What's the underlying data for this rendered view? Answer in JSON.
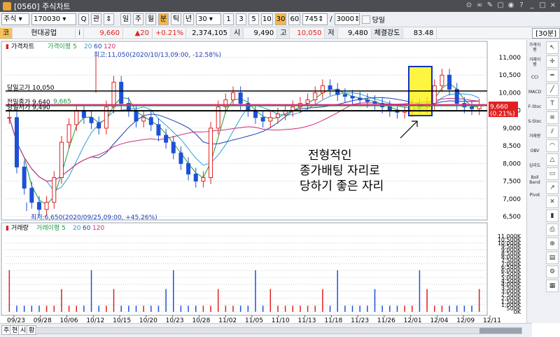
{
  "window": {
    "title": "[0560] 주식차트"
  },
  "toolbar": {
    "market": "주식",
    "code": "170030",
    "search_glyph": "Q",
    "gwan": "관",
    "period_buttons": [
      "일",
      "주",
      "월",
      "분",
      "틱",
      "년"
    ],
    "interval_value": "30",
    "interval_buttons": [
      "1",
      "3",
      "5",
      "10",
      "30",
      "60"
    ],
    "active_interval": "30",
    "count_value": "745",
    "total_value": "3000",
    "sameday_label": "당일"
  },
  "infobar": {
    "market_tag": "코",
    "stock_name": "현대공업",
    "info_glyph": "i",
    "price": "9,660",
    "change": "▲20",
    "change_pct": "+0.21%",
    "volume": "2,374,105",
    "open_label": "시",
    "open": "9,490",
    "high_label": "고",
    "high": "10,050",
    "low_label": "저",
    "low": "9,480",
    "strength_label": "체결강도",
    "strength": "83.48",
    "interval_tag": "[30분]"
  },
  "price_panel": {
    "legend_title": "가격차트",
    "legend_ma": "가격이평 5",
    "legend_ma_periods": [
      "20",
      "60",
      "120"
    ],
    "high_note": "최고:11,050(2020/10/13,09:00, -12.58%)",
    "low_note": "최저:6,650(2020/09/25,09:00, +45.26%)",
    "line_labels": {
      "day_high": "당일고가 10,050",
      "prev_close": "전일종가 9,640",
      "ma_value": "9,665",
      "day_low": "당일저가 9,490"
    },
    "current_price_tag": "9,660",
    "current_pct_tag": "(0.21%)",
    "annotation": [
      "전형적인",
      "종가배팅 자리로",
      "당하기 좋은 자리"
    ]
  },
  "volume_panel": {
    "legend_title": "거래량",
    "legend_ma": "거래이평 5",
    "legend_ma_periods": [
      "20",
      "60",
      "120"
    ]
  },
  "chart_data": {
    "type": "line",
    "title": "가격차트",
    "price_axis": {
      "ylim": [
        6500,
        11000
      ],
      "ticks": [
        11000,
        10500,
        10000,
        9500,
        9000,
        8500,
        8000,
        7500,
        7000,
        6500
      ]
    },
    "volume_axis": {
      "ylim": [
        0,
        11000
      ],
      "tick_labels": [
        "11,000K",
        "10,500K",
        "10,000K",
        "9,500K",
        "9,000K",
        "8,500K",
        "8,000K",
        "7,500K",
        "7,000K",
        "6,500K",
        "6,000K",
        "5,500K",
        "5,000K",
        "4,500K",
        "4,000K",
        "3,500K",
        "3,000K",
        "2,500K",
        "2,000K",
        "1,500K",
        "1,000K",
        "500K",
        "0K"
      ]
    },
    "x_dates": [
      "09/23",
      "09/28",
      "10/06",
      "10/12",
      "10/15",
      "10/20",
      "10/23",
      "10/28",
      "11/02",
      "11/05",
      "11/10",
      "11/13",
      "11/18",
      "11/23",
      "11/26",
      "12/01",
      "12/04",
      "12/09",
      "12/11"
    ],
    "reference_levels": {
      "day_high": 10050,
      "prev_close": 9640,
      "ma_value": 9665,
      "day_low": 9490
    },
    "extremes": {
      "high": 11050,
      "low": 6650
    },
    "price_series": [
      9300,
      7900,
      7300,
      6900,
      6700,
      6900,
      7600,
      8600,
      9100,
      9500,
      9300,
      9150,
      9000,
      9600,
      10300,
      9700,
      9500,
      9200,
      9300,
      9100,
      8800,
      8600,
      8300,
      8000,
      7700,
      7500,
      7600,
      9000,
      9600,
      9800,
      10000,
      9700,
      9500,
      9300,
      9200,
      9300,
      9400,
      9500,
      9600,
      9700,
      9800,
      10000,
      10200,
      10100,
      9950,
      9900,
      9850,
      9800,
      9750,
      9700,
      9600,
      9500,
      9450,
      9500,
      9650,
      9600,
      9700,
      10200,
      10500,
      10100,
      9700,
      9600,
      9550,
      9650
    ]
  },
  "colors": {
    "candle_up": "#e02020",
    "candle_down": "#1d50d6",
    "ma5": "#1a9c3a",
    "ma20": "#2aa0d6",
    "ma60": "#1d3fb0",
    "ma120": "#d4297a",
    "highlight_fill": "#fff200",
    "highlight_border": "#1030c0"
  },
  "rightbar": {
    "indicators": [
      "가격이평",
      "거래이평",
      "CCI",
      "MACD",
      "F-Stoc",
      "S-Stoc",
      "거래량",
      "OBV",
      "심리도",
      "Boll Band",
      "Pivot"
    ]
  },
  "bottombar": {
    "tabs": [
      "주",
      "현",
      "시",
      "황"
    ]
  }
}
